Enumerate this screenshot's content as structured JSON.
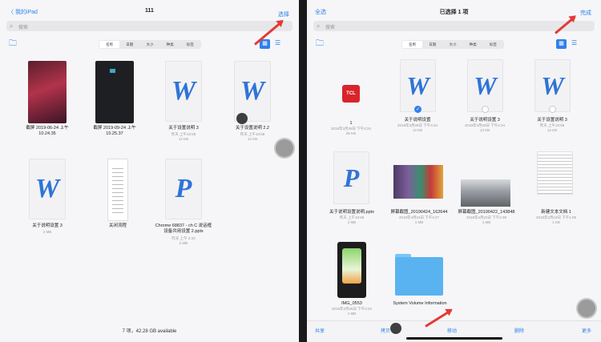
{
  "left": {
    "back_label": "〈 我的iPad",
    "title": "111",
    "action_label": "选择",
    "search_placeholder": "搜索",
    "sort_options": [
      "名称",
      "日期",
      "大小",
      "种类",
      "标签"
    ],
    "files": [
      {
        "name": "截屏 2019-06-24 上午",
        "name2": "10.24.35",
        "meta": ""
      },
      {
        "name": "截屏 2019-09-24 上午",
        "name2": "10.25.37",
        "meta": ""
      },
      {
        "name": "关于设置说明 3",
        "name2": "",
        "meta": "昨天 上午10:58",
        "meta2": "12 KB"
      },
      {
        "name": "关于设置说明 2.2",
        "name2": "",
        "meta": "昨天 上午10:58",
        "meta2": "12 KB"
      },
      {
        "name": "关于说明设置 3",
        "name2": "",
        "meta": "2 MB",
        "meta2": ""
      },
      {
        "name": "关闭流程",
        "name2": "",
        "meta": "",
        "meta2": ""
      },
      {
        "name": "Chrome 68837 - ch C 说话框",
        "name2": "设备共用设置 2.pptx",
        "meta": "昨天 上午 2:33",
        "meta2": "2 MB"
      }
    ],
    "footer": "7 项，42.28 GB available",
    "letter_w": "W",
    "letter_p": "P"
  },
  "right": {
    "select_all_label": "全选",
    "title": "已选择 1 项",
    "done_label": "完成",
    "search_placeholder": "搜索",
    "sort_options": [
      "名称",
      "日期",
      "大小",
      "种类",
      "标签"
    ],
    "files": [
      {
        "name": "1",
        "meta": "2019年3月28日 下午4:34",
        "meta2": "25 KB",
        "badge": "TCL"
      },
      {
        "name": "关于说明设置",
        "meta": "2019年3月28日 下午4:34",
        "meta2": "12 KB",
        "selected": true
      },
      {
        "name": "关于说明设置 3",
        "meta": "2019年3月28日 下午4:34",
        "meta2": "12 KB"
      },
      {
        "name": "关于设置说明 3",
        "meta": "昨天 上午10:58",
        "meta2": "12 KB"
      },
      {
        "name": "关于说明设置说明.pptx",
        "meta": "昨天 上午10:58",
        "meta2": "2 MB"
      },
      {
        "name": "屏幕截图_20190424_162644",
        "meta": "2019年4月24日 下午4:27",
        "meta2": "1 MB"
      },
      {
        "name": "屏幕截图_20190422_143848",
        "meta": "2019年4月22日 下午2:38",
        "meta2": "1 MB"
      },
      {
        "name": "新建文本文档 1",
        "meta": "2019年3月18日 下午1:09",
        "meta2": "1 KB"
      },
      {
        "name": "IMG_0553",
        "meta": "2019年3月28日 下午4:34",
        "meta2": "1 MB"
      },
      {
        "name": "System Volume Information",
        "meta": "",
        "meta2": ""
      }
    ],
    "bottom": {
      "share": "共享",
      "copy": "拷贝",
      "move": "移动",
      "delete": "删除",
      "more": "更多"
    },
    "letter_w": "W",
    "letter_p": "P",
    "check": "✓"
  },
  "colors": {
    "accent": "#2f80ed",
    "arrow": "#e53935",
    "folder": "#5ab3f1"
  },
  "icons": {
    "search": "search-icon",
    "folder": "folder-icon",
    "grid": "grid-view-icon",
    "list": "list-view-icon"
  }
}
